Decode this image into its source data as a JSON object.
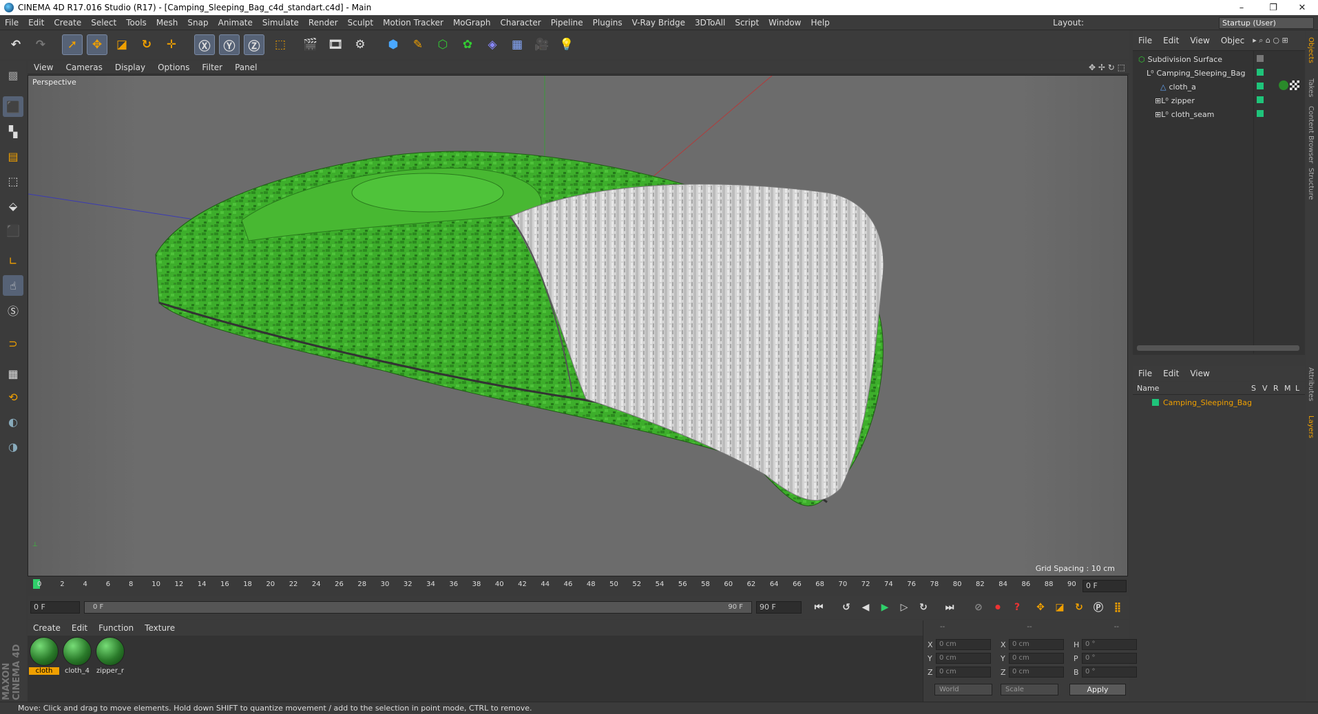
{
  "window": {
    "title": "CINEMA 4D R17.016 Studio (R17) - [Camping_Sleeping_Bag_c4d_standart.c4d] - Main",
    "minimize": "–",
    "maximize": "❐",
    "close": "✕"
  },
  "menubar": [
    "File",
    "Edit",
    "Create",
    "Select",
    "Tools",
    "Mesh",
    "Snap",
    "Animate",
    "Simulate",
    "Render",
    "Sculpt",
    "Motion Tracker",
    "MoGraph",
    "Character",
    "Pipeline",
    "Plugins",
    "V-Ray Bridge",
    "3DToAll",
    "Script",
    "Window",
    "Help"
  ],
  "layout": {
    "label": "Layout:",
    "value": "Startup (User)"
  },
  "viewport": {
    "menu": [
      "View",
      "Cameras",
      "Display",
      "Options",
      "Filter",
      "Panel"
    ],
    "label": "Perspective",
    "grid_spacing": "Grid Spacing : 10 cm"
  },
  "timeline": {
    "ticks": [
      "0",
      "2",
      "4",
      "6",
      "8",
      "10",
      "12",
      "14",
      "16",
      "18",
      "20",
      "22",
      "24",
      "26",
      "28",
      "30",
      "32",
      "34",
      "36",
      "38",
      "40",
      "42",
      "44",
      "46",
      "48",
      "50",
      "52",
      "54",
      "56",
      "58",
      "60",
      "62",
      "64",
      "66",
      "68",
      "70",
      "72",
      "74",
      "76",
      "78",
      "80",
      "82",
      "84",
      "86",
      "88",
      "90"
    ],
    "current_frame": "0 F",
    "start": "0 F",
    "range_start": "0 F",
    "range_end": "90 F",
    "end": "90 F"
  },
  "materials": {
    "menu": [
      "Create",
      "Edit",
      "Function",
      "Texture"
    ],
    "items": [
      {
        "name": "cloth",
        "selected": true
      },
      {
        "name": "cloth_4",
        "selected": false
      },
      {
        "name": "zipper_r",
        "selected": false
      }
    ]
  },
  "coordinates": {
    "header": [
      "--",
      "--",
      "--"
    ],
    "rows": [
      {
        "a": "X",
        "av": "0 cm",
        "b": "X",
        "bv": "0 cm",
        "c": "H",
        "cv": "0 °"
      },
      {
        "a": "Y",
        "av": "0 cm",
        "b": "Y",
        "bv": "0 cm",
        "c": "P",
        "cv": "0 °"
      },
      {
        "a": "Z",
        "av": "0 cm",
        "b": "Z",
        "bv": "0 cm",
        "c": "B",
        "cv": "0 °"
      }
    ],
    "mode1": "World",
    "mode2": "Scale",
    "apply": "Apply"
  },
  "objects": {
    "menu": [
      "File",
      "Edit",
      "View",
      "Objec"
    ],
    "tree": [
      {
        "name": "Subdivision Surface",
        "indent": 0
      },
      {
        "name": "Camping_Sleeping_Bag",
        "indent": 1
      },
      {
        "name": "cloth_a",
        "indent": 2
      },
      {
        "name": "zipper",
        "indent": 2
      },
      {
        "name": "cloth_seam",
        "indent": 2
      }
    ]
  },
  "layers": {
    "menu": [
      "File",
      "Edit",
      "View"
    ],
    "columns": [
      "Name",
      "S",
      "V",
      "R",
      "M",
      "L"
    ],
    "items": [
      {
        "name": "Camping_Sleeping_Bag"
      }
    ]
  },
  "right_tabs": [
    "Objects",
    "Takes",
    "Content Browser",
    "Structure",
    "Attributes",
    "Layers"
  ],
  "status": "Move: Click and drag to move elements. Hold down SHIFT to quantize movement / add to the selection in point mode, CTRL to remove.",
  "brand": "MAXON CINEMA 4D",
  "colors": {
    "accent": "#f0a000",
    "object_green": "#1fc47a",
    "bag_green": "#3caa2a"
  }
}
